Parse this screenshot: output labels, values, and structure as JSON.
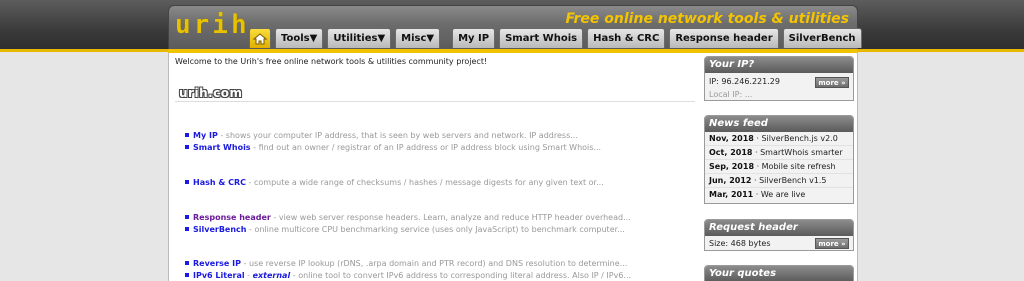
{
  "header": {
    "logo": "urih",
    "tagline": "Free online  network tools & utilities"
  },
  "menu": {
    "home_icon": "home-icon",
    "items": [
      {
        "label": "Tools▼"
      },
      {
        "label": "Utilities▼"
      },
      {
        "label": "Misc▼"
      },
      {
        "label": "My IP"
      },
      {
        "label": "Smart Whois"
      },
      {
        "label": "Hash & CRC"
      },
      {
        "label": "Response header"
      },
      {
        "label": "SilverBench"
      }
    ]
  },
  "main": {
    "welcome": "Welcome to the Urih's free online network tools & utilities community project!",
    "section_title": "urih.com",
    "tools": [
      {
        "name": "My IP",
        "desc": "shows your computer IP address, that is seen by web servers and network. IP address..."
      },
      {
        "name": "Smart Whois",
        "desc": "find out an owner / registrar of an IP address or IP address block using Smart Whois..."
      },
      {
        "name": "Hash & CRC",
        "desc": "compute a wide range of checksums / hashes / message digests for any given text or..."
      },
      {
        "name": "Response header",
        "desc": "view web server response headers. Learn, analyze and reduce HTTP header overhead..."
      },
      {
        "name": "SilverBench",
        "desc": "online multicore CPU benchmarking service (uses only JavaScript) to benchmark computer..."
      },
      {
        "name": "Reverse IP",
        "desc": "use reverse IP lookup (rDNS, .arpa domain and PTR record) and DNS resolution to determine..."
      },
      {
        "name": "IPv6 Literal",
        "ext": "external",
        "desc": "online tool to convert IPv6 address to corresponding literal address. Also IP / IPv6..."
      }
    ]
  },
  "sidebar": {
    "your_ip": {
      "title": "Your IP?",
      "ip_line": "IP: 96.246.221.29",
      "local_line": "Local IP: ...",
      "more": "more »"
    },
    "news": {
      "title": "News feed",
      "items": [
        {
          "date": "Nov, 2018",
          "text": "· SilverBench.js v2.0"
        },
        {
          "date": "Oct, 2018",
          "text": "· SmartWhois smarter"
        },
        {
          "date": "Sep, 2018",
          "text": "· Mobile site refresh"
        },
        {
          "date": "Jun, 2012",
          "text": "· SilverBench v1.5"
        },
        {
          "date": "Mar, 2011",
          "text": "· We are live"
        }
      ]
    },
    "request_header": {
      "title": "Request header",
      "size_line": "Size: 468 bytes",
      "more": "more »"
    },
    "quotes": {
      "title": "Your quotes"
    }
  },
  "colors": {
    "accent_yellow": "#f0c200",
    "link_blue": "#1a1ae0",
    "visited_purple": "#6a1a9a",
    "header_gray": "#6d6d6d"
  }
}
